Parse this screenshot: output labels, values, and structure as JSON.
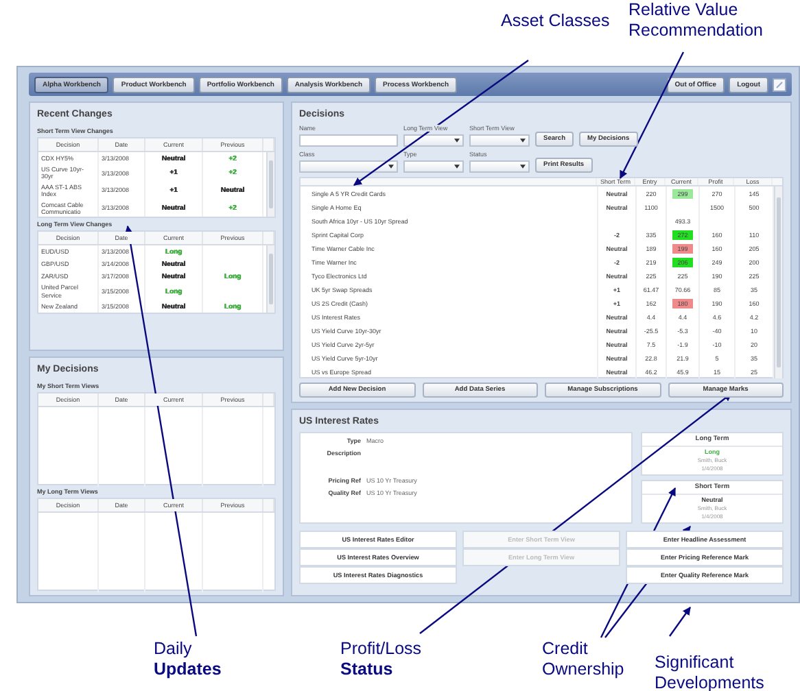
{
  "callouts": [
    {
      "text": "Asset Classes"
    },
    {
      "text": "Relative Value Recommendation"
    },
    {
      "text": "Daily **Updates**"
    },
    {
      "text": "Profit/Loss **Status**"
    },
    {
      "text": "Credit Ownership"
    },
    {
      "text": "Significant Developments"
    }
  ],
  "tabs": [
    {
      "label": "Alpha Workbench",
      "selected": true
    },
    {
      "label": "Product Workbench",
      "selected": false
    },
    {
      "label": "Portfolio Workbench",
      "selected": false
    },
    {
      "label": "Analysis Workbench",
      "selected": false
    },
    {
      "label": "Process Workbench",
      "selected": false
    }
  ],
  "header_buttons": [
    "Out of Office",
    "Logout"
  ],
  "recent_changes": {
    "title": "Recent Changes",
    "sections": [
      {
        "title": "Short Term View Changes",
        "columns": [
          "Decision",
          "Date",
          "Current",
          "Previous"
        ],
        "rows": [
          {
            "decision": "CDX HY5%",
            "date": "3/13/2008",
            "current": {
              "text": "Neutral",
              "color": "#333333"
            },
            "previous": {
              "text": "+2",
              "color": "#3fae3f"
            }
          },
          {
            "decision": "US Curve 10yr-30yr",
            "date": "3/13/2008",
            "current": {
              "text": "+1",
              "color": "#333333"
            },
            "previous": {
              "text": "+2",
              "color": "#3fae3f"
            }
          },
          {
            "decision": "AAA ST-1 ABS Index",
            "date": "3/13/2008",
            "current": {
              "text": "+1",
              "color": "#333333"
            },
            "previous": {
              "text": "Neutral",
              "color": "#333333"
            }
          },
          {
            "decision": "Comcast Cable Communicatio",
            "date": "3/13/2008",
            "current": {
              "text": "Neutral",
              "color": "#333333"
            },
            "previous": {
              "text": "+2",
              "color": "#3fae3f"
            }
          }
        ]
      },
      {
        "title": "Long Term View Changes",
        "columns": [
          "Decision",
          "Date",
          "Current",
          "Previous"
        ],
        "rows": [
          {
            "decision": "EUD/USD",
            "date": "3/13/2008",
            "current": {
              "text": "Long",
              "color": "#3fae3f"
            }
          },
          {
            "decision": "GBP/USD",
            "date": "3/14/2008",
            "current": {
              "text": "Neutral",
              "color": "#333333"
            }
          },
          {
            "decision": "ZAR/USD",
            "date": "3/17/2008",
            "current": {
              "text": "Neutral",
              "color": "#333333"
            },
            "previous": {
              "text": "Long",
              "color": "#3fae3f"
            }
          },
          {
            "decision": "United Parcel Service",
            "date": "3/15/2008",
            "current": {
              "text": "Long",
              "color": "#3fae3f"
            }
          },
          {
            "decision": "New Zealand",
            "date": "3/15/2008",
            "current": {
              "text": "Neutral",
              "color": "#333333"
            },
            "previous": {
              "text": "Long",
              "color": "#3fae3f"
            }
          }
        ]
      }
    ]
  },
  "my_decisions": {
    "title": "My Decisions",
    "sections": [
      {
        "title": "My Short Term Views",
        "columns": [
          "Decision",
          "Date",
          "Current",
          "Previous"
        ]
      },
      {
        "title": "My Long Term Views",
        "columns": [
          "Decision",
          "Date",
          "Current",
          "Previous"
        ]
      }
    ]
  },
  "decisions": {
    "title": "Decisions",
    "filter_rows": [
      {
        "fields": [
          {
            "label": "Name",
            "kind": "text"
          },
          {
            "label": "Long Term View",
            "kind": "select"
          },
          {
            "label": "Short Term View",
            "kind": "select"
          }
        ],
        "buttons": [
          "Search",
          "My Decisions"
        ]
      },
      {
        "fields": [
          {
            "label": "Class",
            "kind": "select"
          },
          {
            "label": "Type",
            "kind": "select"
          },
          {
            "label": "Status",
            "kind": "select"
          }
        ],
        "buttons": [
          "Print Results"
        ]
      }
    ],
    "table": {
      "columns": [
        "Short Term",
        "Entry",
        "Current",
        "Profit",
        "Loss"
      ],
      "rows": [
        {
          "name": "Single A 5 YR Credit Cards",
          "short_term": "Neutral",
          "entry": "220",
          "current": "299",
          "profit": "270",
          "loss": "145",
          "color": "#9be89b"
        },
        {
          "name": "Single A Home Eq",
          "short_term": "Neutral",
          "entry": "1100",
          "profit": "1500",
          "loss": "500"
        },
        {
          "name": "South Africa 10yr - US 10yr Spread",
          "current": "493.3"
        },
        {
          "name": "Sprint Capital Corp",
          "short_term": "-2",
          "entry": "335",
          "current": "272",
          "profit": "160",
          "loss": "110",
          "color": "#22dd22"
        },
        {
          "name": "Time Warner Cable Inc",
          "short_term": "Neutral",
          "entry": "189",
          "current": "199",
          "profit": "160",
          "loss": "205",
          "color": "#f08a8a"
        },
        {
          "name": "Time Warner Inc",
          "short_term": "-2",
          "entry": "219",
          "current": "206",
          "profit": "249",
          "loss": "200",
          "color": "#22dd22"
        },
        {
          "name": "Tyco Electronics Ltd",
          "short_term": "Neutral",
          "entry": "225",
          "current": "225",
          "profit": "190",
          "loss": "225"
        },
        {
          "name": "UK 5yr Swap Spreads",
          "short_term": "+1",
          "entry": "61.47",
          "current": "70.66",
          "profit": "85",
          "loss": "35"
        },
        {
          "name": "US 2S Credit (Cash)",
          "short_term": "+1",
          "entry": "162",
          "current": "180",
          "profit": "190",
          "loss": "160",
          "color": "#f08a8a"
        },
        {
          "name": "US Interest Rates",
          "short_term": "Neutral",
          "entry": "4.4",
          "current": "4.4",
          "profit": "4.6",
          "loss": "4.2"
        },
        {
          "name": "US Yield Curve 10yr-30yr",
          "short_term": "Neutral",
          "entry": "-25.5",
          "current": "-5.3",
          "profit": "-40",
          "loss": "10"
        },
        {
          "name": "US Yield Curve 2yr-5yr",
          "short_term": "Neutral",
          "entry": "7.5",
          "current": "-1.9",
          "profit": "-10",
          "loss": "20"
        },
        {
          "name": "US Yield Curve 5yr-10yr",
          "short_term": "Neutral",
          "entry": "22.8",
          "current": "21.9",
          "profit": "5",
          "loss": "35"
        },
        {
          "name": "US vs Europe Spread",
          "short_term": "Neutral",
          "entry": "46.2",
          "current": "45.9",
          "profit": "15",
          "loss": "25"
        }
      ]
    },
    "actions": [
      "Add New Decision",
      "Add Data Series",
      "Manage Subscriptions",
      "Manage Marks"
    ]
  },
  "detail": {
    "title": "US Interest Rates",
    "fields": [
      {
        "label": "Type",
        "value": "Macro"
      },
      {
        "label": "Description"
      },
      {
        "label": "Pricing Ref",
        "value": "US 10 Yr Treasury"
      },
      {
        "label": "Quality Ref",
        "value": "US 10 Yr Treasury"
      }
    ],
    "views": [
      {
        "title": "Long Term",
        "view": "Long",
        "color": "#3fae3f",
        "owner": "Smith, Buck",
        "date": "1/4/2008"
      },
      {
        "title": "Short Term",
        "view": "Neutral",
        "color": "#333333",
        "owner": "Smith, Buck",
        "date": "1/4/2008"
      }
    ],
    "button_columns": [
      [
        {
          "label": "US Interest Rates Editor",
          "disabled": false
        },
        {
          "label": "US Interest Rates Overview",
          "disabled": false
        },
        {
          "label": "US Interest Rates Diagnostics",
          "disabled": false
        }
      ],
      [
        {
          "label": "Enter Short Term View",
          "disabled": true
        },
        {
          "label": "Enter Long Term View",
          "disabled": true
        }
      ],
      [
        {
          "label": "Enter Headline Assessment",
          "disabled": false
        },
        {
          "label": "Enter Pricing Reference Mark",
          "disabled": false
        },
        {
          "label": "Enter Quality Reference Mark",
          "disabled": false
        }
      ]
    ]
  }
}
